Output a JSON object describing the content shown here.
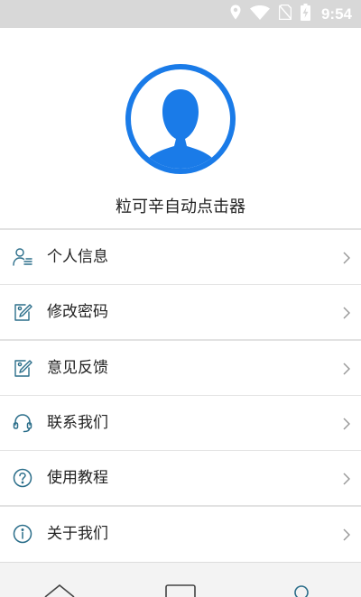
{
  "status_bar": {
    "time": "9:54",
    "icons": [
      "location-icon",
      "wifi-icon",
      "no-sim-icon",
      "battery-charging-icon"
    ]
  },
  "profile": {
    "avatar_icon": "user-avatar-icon",
    "app_name": "粒可辛自动点击器"
  },
  "menu": {
    "personal_info": "个人信息",
    "change_password": "修改密码",
    "feedback": "意见反馈",
    "contact_us": "联系我们",
    "tutorial": "使用教程",
    "about_us": "关于我们"
  },
  "bottom_nav": {
    "items": [
      "home-icon",
      "window-icon",
      "user-icon"
    ]
  },
  "colors": {
    "accent": "#1a7be8",
    "icon": "#2b6e8a",
    "status_bar": "#d8d8d8"
  }
}
